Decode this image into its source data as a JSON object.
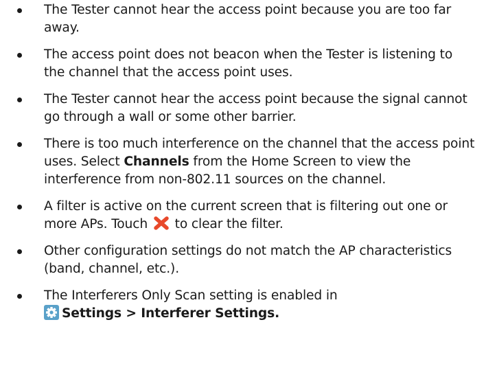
{
  "bullets": [
    {
      "text": "The Tester cannot hear the access point because you are too far away."
    },
    {
      "text": "The access point does not beacon when the Tester is listening to the channel that the access point uses."
    },
    {
      "text": "The Tester cannot hear the access point because the signal cannot go through a wall or some other barrier."
    },
    {
      "pre": "There is too much interference on the channel that the access point uses. Select ",
      "bold": "Channels",
      "post": " from the Home Screen to view the interference from non-802.11 sources on the channel."
    },
    {
      "pre": "A filter is active on the current screen that is filtering out one or more APs. Touch ",
      "post": " to clear the filter."
    },
    {
      "text": "Other configuration settings do not match the AP characteristics (band, channel, etc.)."
    },
    {
      "pre": "The Interferers Only Scan setting is enabled in",
      "bold": "Settings > Interferer Settings."
    }
  ],
  "icons": {
    "clear_filter": "close-x-icon",
    "settings": "gear-icon"
  },
  "colors": {
    "text": "#1a1a1a",
    "clear_icon": "#e8492b",
    "settings_icon_bg": "#5aa1c9"
  }
}
